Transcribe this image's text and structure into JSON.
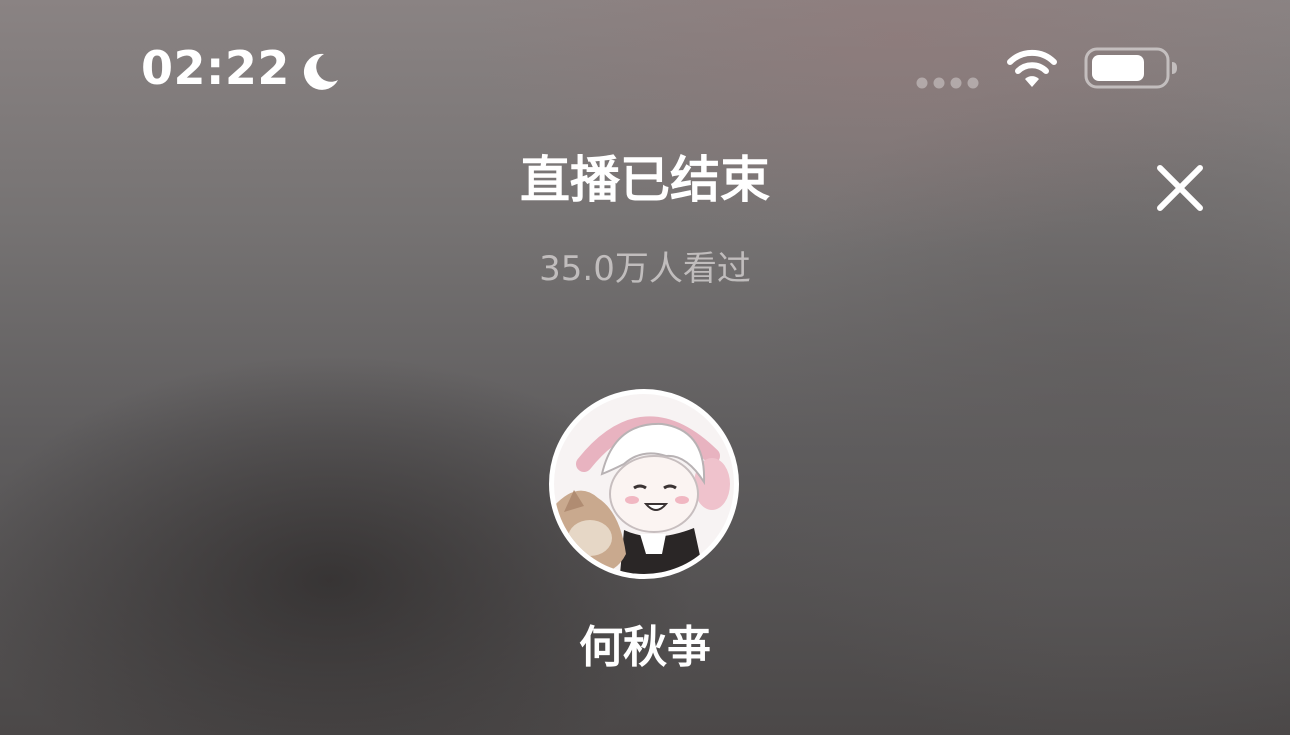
{
  "status_bar": {
    "time": "02:22",
    "icons": [
      "moon-icon",
      "signal-icon",
      "wifi-icon",
      "battery-icon"
    ]
  },
  "header": {
    "title": "直播已结束",
    "viewers": "35.0万人看过",
    "close_icon": "close-icon"
  },
  "host": {
    "name": "何秋亊",
    "avatar": "avatar-icon"
  },
  "colors": {
    "text": "#ffffff",
    "subtext": "#bdbaba",
    "background": "#6a6767"
  }
}
